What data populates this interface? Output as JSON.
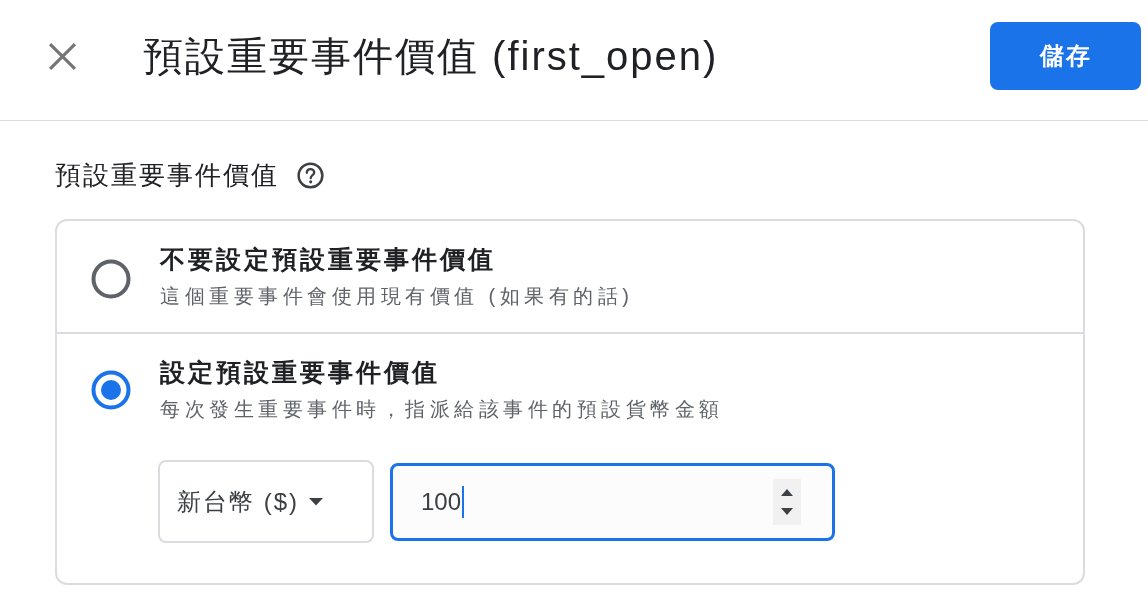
{
  "dialog": {
    "title": "預設重要事件價值 (first_open)",
    "save_button": "儲存"
  },
  "section": {
    "label": "預設重要事件價值",
    "options": [
      {
        "title": "不要設定預設重要事件價值",
        "description": "這個重要事件會使用現有價值 (如果有的話)",
        "selected": false
      },
      {
        "title": "設定預設重要事件價值",
        "description": "每次發生重要事件時，指派給該事件的預設貨幣金額",
        "selected": true,
        "currency": {
          "value": "新台幣 ($)"
        },
        "amount": {
          "value": "100",
          "focused": true
        }
      }
    ]
  }
}
